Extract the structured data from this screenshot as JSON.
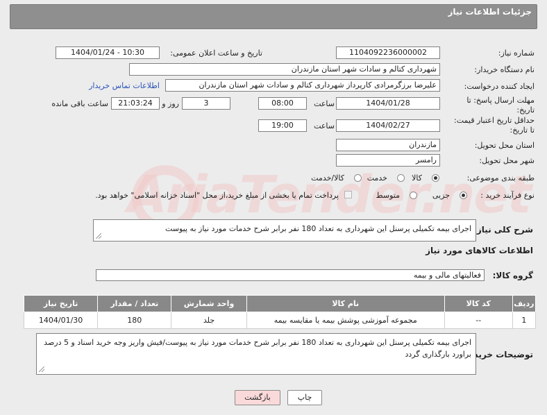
{
  "header": {
    "title": "جزئیات اطلاعات نیاز"
  },
  "form": {
    "need_number_label": "شماره نیاز:",
    "need_number": "1104092236000002",
    "announce_label": "تاریخ و ساعت اعلان عمومی:",
    "announce_value": "1404/01/24 - 10:30",
    "buyer_org_label": "نام دستگاه خریدار:",
    "buyer_org": "شهرداری کتالم و سادات شهر استان مازندران",
    "creator_label": "ایجاد کننده درخواست:",
    "creator": "علیرضا برزگرمرادی کارپرداز شهرداری کتالم و سادات شهر استان مازندران",
    "contact_link": "اطلاعات تماس خریدار",
    "deadline_label": "مهلت ارسال پاسخ: تا تاریخ:",
    "deadline_date": "1404/01/28",
    "time_label": "ساعت",
    "deadline_time": "08:00",
    "days_value": "3",
    "days_label": "روز و",
    "remaining_time": "21:03:24",
    "remaining_label": "ساعت باقی مانده",
    "validity_label": "حداقل تاریخ اعتبار قیمت: تا تاریخ:",
    "validity_date": "1404/02/27",
    "validity_time": "19:00",
    "province_label": "استان محل تحویل:",
    "province": "مازندران",
    "city_label": "شهر محل تحویل:",
    "city": "رامسر",
    "category_label": "طبقه بندی موضوعی:",
    "category_options": [
      "کالا",
      "خدمت",
      "کالا/خدمت"
    ],
    "category_selected": "کالا",
    "process_label": "نوع فرآیند خرید :",
    "process_options": [
      "جزیی",
      "متوسط"
    ],
    "process_selected": "جزیی",
    "payment_note": "پرداخت تمام یا بخشی از مبلغ خرید،از محل \"اسناد خزانه اسلامی\" خواهد بود."
  },
  "description": {
    "label": "شرح کلی نیاز:",
    "text": "اجرای بیمه تکمیلی پرسنل این شهرداری به تعداد 180 نفر برابر شرح خدمات مورد نیاز به پیوست"
  },
  "goods": {
    "section_title": "اطلاعات کالاهای مورد نیاز",
    "group_label": "گروه کالا:",
    "group_value": "فعالیتهای مالی و بیمه",
    "columns": [
      "ردیف",
      "کد کالا",
      "نام کالا",
      "واحد شمارش",
      "تعداد / مقدار",
      "تاریخ نیاز"
    ],
    "rows": [
      {
        "row": "1",
        "code": "--",
        "name": "مجموعه آموزشی پوشش بیمه یا مقایسه بیمه",
        "unit": "جلد",
        "qty": "180",
        "date": "1404/01/30"
      }
    ]
  },
  "buyer_notes": {
    "label": "توضیحات خریدار:",
    "text": "اجرای بیمه تکمیلی پرسنل این شهرداری به تعداد 180 نفر برابر شرح خدمات مورد نیاز به پیوست/فیش واریز وجه خرید اسناد و 5 درصد براورد بارگذاری گردد"
  },
  "buttons": {
    "print": "چاپ",
    "back": "بازگشت"
  },
  "watermark": {
    "text": "AriaTender.net"
  }
}
